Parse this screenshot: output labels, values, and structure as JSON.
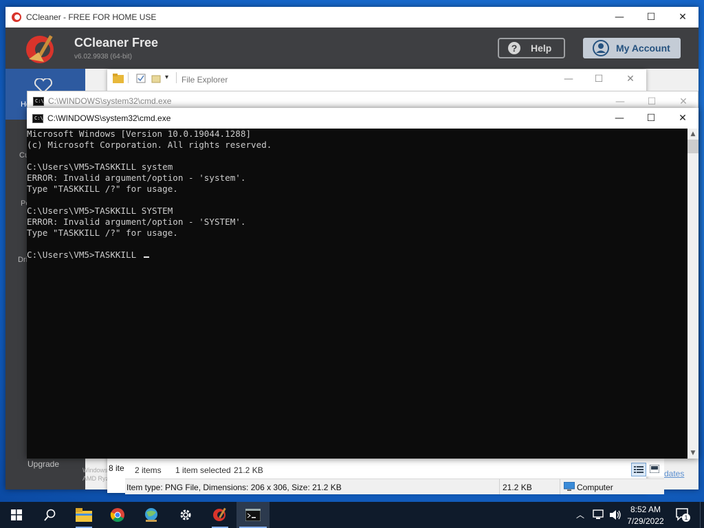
{
  "ccleaner": {
    "window_title": "CCleaner - FREE FOR HOME USE",
    "app_name": "CCleaner Free",
    "version": "v6.02.9938 (64-bit)",
    "help_label": "Help",
    "account_label": "My Account",
    "sidebar_partial": [
      "He",
      "Cu",
      "Pe",
      "Dri"
    ],
    "upgrade_label": "Upgrade",
    "sysinfo_line1": "Windows",
    "sysinfo_line2": "AMD Ryzen",
    "updates_partial": "dates"
  },
  "file_explorer": {
    "title": "File Explorer",
    "items_partial": "8 ite",
    "item_count": "2 items",
    "selection": "1 item selected",
    "selection_size": "21.2 KB",
    "details": "Item type: PNG File, Dimensions: 206 x 306, Size: 21.2 KB",
    "details_size": "21.2 KB",
    "location": "Computer"
  },
  "cmd_back": {
    "title": "C:\\WINDOWS\\system32\\cmd.exe"
  },
  "cmd_front": {
    "title": "C:\\WINDOWS\\system32\\cmd.exe",
    "lines": [
      "Microsoft Windows [Version 10.0.19044.1288]",
      "(c) Microsoft Corporation. All rights reserved.",
      "",
      "C:\\Users\\VM5>TASKKILL system",
      "ERROR: Invalid argument/option - 'system'.",
      "Type \"TASKKILL /?\" for usage.",
      "",
      "C:\\Users\\VM5>TASKKILL SYSTEM",
      "ERROR: Invalid argument/option - 'SYSTEM'.",
      "Type \"TASKKILL /?\" for usage.",
      "",
      "C:\\Users\\VM5>TASKKILL "
    ]
  },
  "taskbar": {
    "time": "8:52 AM",
    "date": "7/29/2022",
    "notification_count": "1",
    "apps": [
      "start-icon",
      "search-icon",
      "file-explorer-icon",
      "chrome-icon",
      "network-globe-icon",
      "settings-gear-icon",
      "ccleaner-icon",
      "cmd-icon"
    ]
  },
  "colors": {
    "desktop_blue": "#1565c8",
    "ccleaner_header": "#3e3f42",
    "console_bg": "#0c0c0c",
    "console_text": "#cccccc",
    "taskbar": "#0f1b2b"
  }
}
